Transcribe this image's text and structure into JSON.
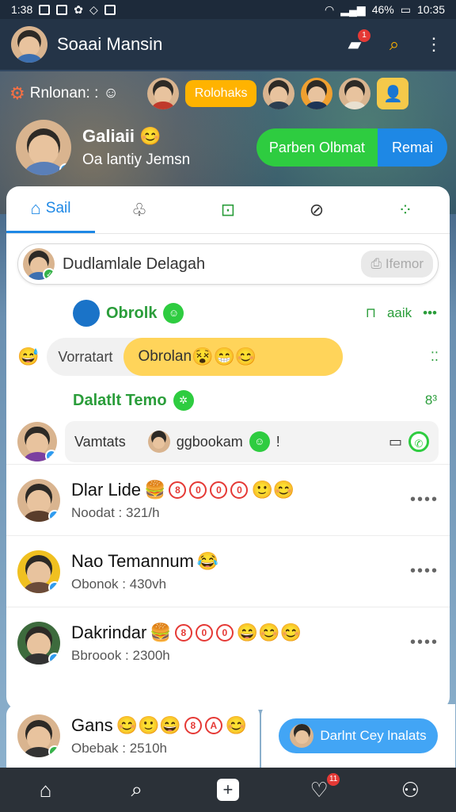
{
  "status_bar": {
    "time": "1:38",
    "battery": "46%",
    "time_right": "10:35"
  },
  "app_bar": {
    "title": "Soaai Mansin",
    "notif_badge": "1"
  },
  "story_row": {
    "label": "Rnlonan: :",
    "pill": "Rolohaks"
  },
  "profile": {
    "name": "Galiaii",
    "subtitle": "Oa lantiy Jemsn",
    "btn_green": "Parben Olbmat",
    "btn_blue": "Remai"
  },
  "tabs": [
    {
      "label": "Sail"
    },
    {
      "label": ""
    },
    {
      "label": ""
    },
    {
      "label": ""
    },
    {
      "label": ""
    }
  ],
  "search": {
    "text": "Dudlamlale Delagah",
    "button": "Ifemor"
  },
  "section1": {
    "title": "Obrolk",
    "right": "aaik"
  },
  "bubble1": {
    "left": "Vorratart",
    "right": "Obrolan"
  },
  "section2": {
    "title": "Dalatlt Temo",
    "right": "8³"
  },
  "msg_row": {
    "left": "Vamtats",
    "right": "ggbookam"
  },
  "chats": [
    {
      "name": "Dlar Lide",
      "sub": "Noodat : 321/h"
    },
    {
      "name": "Nao Temannum",
      "sub": "Obonok : 430vh"
    },
    {
      "name": "Dakrindar",
      "sub": "Bbroook : 2300h"
    }
  ],
  "bottom_chat": {
    "name": "Gans",
    "sub": "Obebak : 2510h"
  },
  "bottom_button": "Darlnt Cey lnalats",
  "nav": {
    "badge": "11"
  }
}
